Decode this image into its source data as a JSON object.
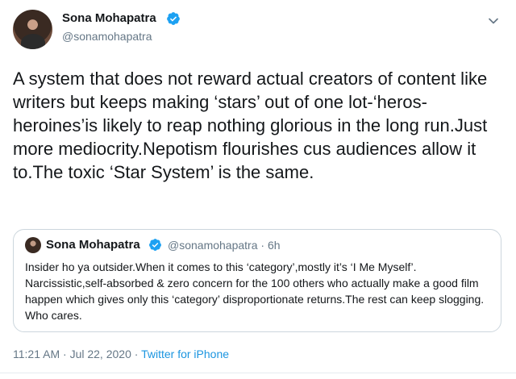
{
  "author": {
    "name": "Sona Mohapatra",
    "handle": "@sonamohapatra"
  },
  "tweet": {
    "text": "A system that does not reward actual creators of content like writers but keeps making ‘stars’ out of one lot-‘heros-heroines’is likely to reap nothing glorious in the long run.Just more mediocrity.Nepotism flourishes cus audiences allow it to.The toxic ‘Star System’ is the same."
  },
  "quoted": {
    "name": "Sona Mohapatra",
    "handle": "@sonamohapatra",
    "separator": "·",
    "age": "6h",
    "text": "Insider ho ya outsider.When it comes to this ‘category’,mostly it’s ‘I Me Myself’. Narcissistic,self-absorbed & zero concern for the 100 others who actually make a good film happen which gives only this ‘category’ disproportionate returns.The rest can keep slogging. Who cares."
  },
  "meta": {
    "time": "11:21 AM",
    "dot": "·",
    "date": "Jul 22, 2020",
    "dot2": "·",
    "source": "Twitter for iPhone"
  },
  "colors": {
    "verified": "#1da1f2",
    "link": "#1b95e0",
    "muted": "#657786"
  },
  "icons": {
    "verified": "verified-badge-icon",
    "more": "chevron-down-icon"
  }
}
